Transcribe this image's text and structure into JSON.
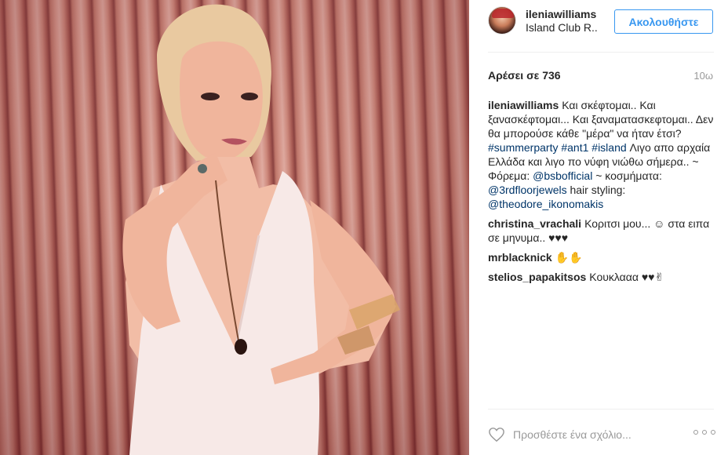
{
  "post": {
    "username": "ileniawilliams",
    "location": "Island Club R..",
    "follow_label": "Ακολουθήστε",
    "likes": "Αρέσει σε 736",
    "time": "10ω",
    "caption": {
      "user": "ileniawilliams",
      "text1": "Και σκέφτομαι.. Και ξανασκέφτομαι... Και ξαναματασκεφτομαι.. Δεν θα μπορούσε κάθε \"μέρα\" να ήταν έτσι?",
      "tags": "#summerparty #ant1 #island",
      "text2": "Λιγο απο αρχαία Ελλάδα και λιγο πο νύφη νιώθω σήμερα.. ~ Φόρεμα:",
      "mention1": "@bsbofficial",
      "text3": "~ κοσμήματα:",
      "mention2": "@3rdfloorjewels",
      "text4": "hair styling:",
      "mention3": "@theodore_ikonomakis"
    },
    "comments": [
      {
        "user": "christina_vrachali",
        "text": "Κοριτσι μου... ☺ στα ειπα σε μηνυμα.. ♥♥♥"
      },
      {
        "user": "mrblacknick",
        "text": "✋✋"
      },
      {
        "user": "stelios_papakitsos",
        "text": "Κουκλααα ♥♥✌"
      }
    ],
    "comment_placeholder": "Προσθέστε ένα σχόλιο...",
    "heart_icon": "heart-outline-icon",
    "more_icon": "more-options-icon"
  },
  "colors": {
    "accent": "#3897f0",
    "link": "#003569",
    "muted": "#999999",
    "text": "#262626"
  }
}
